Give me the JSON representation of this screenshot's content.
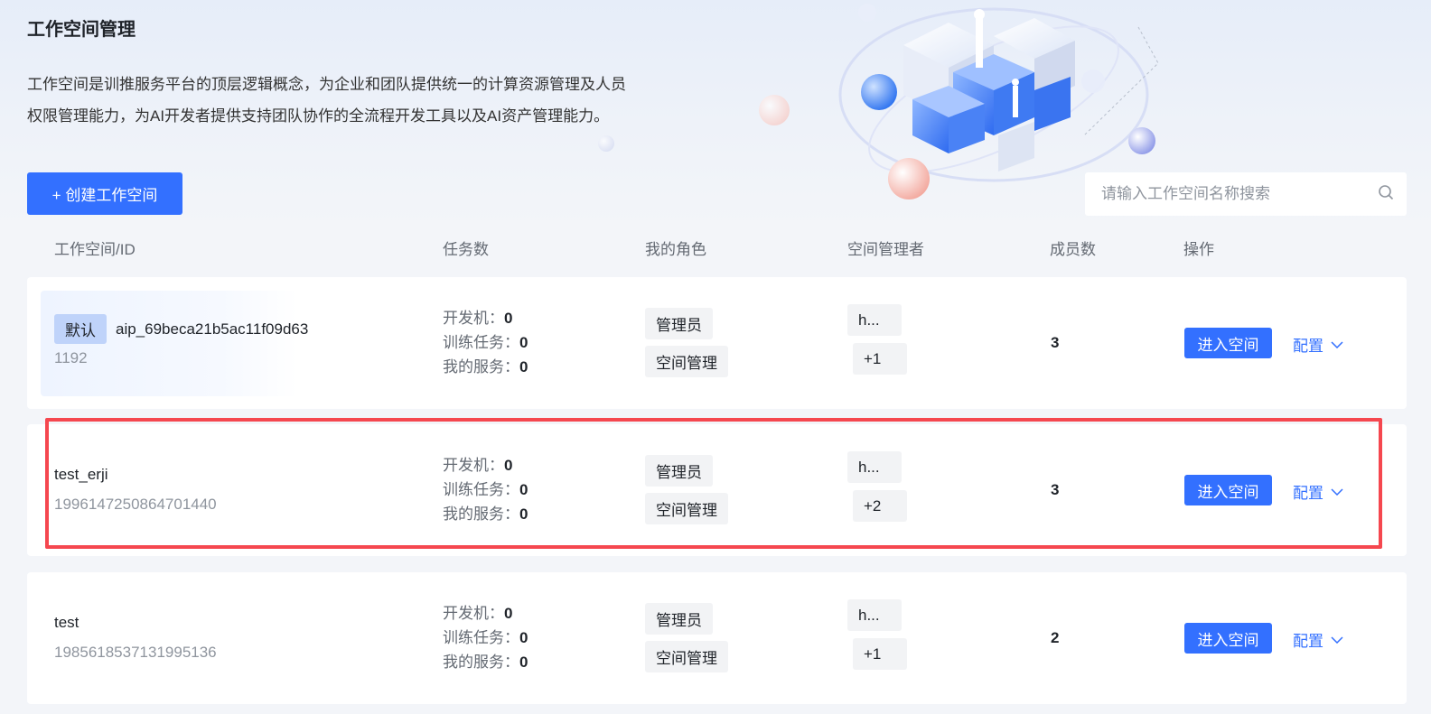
{
  "page": {
    "title": "工作空间管理",
    "intro_line1": "工作空间是训推服务平台的顶层逻辑概念，为企业和团队提供统一的计算资源管理及人员",
    "intro_line2": "权限管理能力，为AI开发者提供支持团队协作的全流程开发工具以及AI资产管理能力。"
  },
  "toolbar": {
    "create_label": "+ 创建工作空间",
    "search_placeholder": "请输入工作空间名称搜索",
    "search_icon": "search-icon"
  },
  "columns": {
    "workspace": "工作空间/ID",
    "tasks": "任务数",
    "role": "我的角色",
    "manager": "空间管理者",
    "members": "成员数",
    "actions": "操作"
  },
  "task_labels": {
    "dev": "开发机：",
    "train": "训练任务：",
    "service": "我的服务："
  },
  "rows": [
    {
      "tag": "默认",
      "name": "aip_69beca21b5ac11f09d63",
      "id": "1192",
      "dev": "0",
      "train": "0",
      "service": "0",
      "role1": "管理员",
      "role2": "空间管理",
      "manager": "h...",
      "manager_more": "+1",
      "members": "3",
      "enter_label": "进入空间",
      "config_label": "配置"
    },
    {
      "name": "test_erji",
      "id": "1996147250864701440",
      "dev": "0",
      "train": "0",
      "service": "0",
      "role1": "管理员",
      "role2": "空间管理",
      "manager": "h...",
      "manager_more": "+2",
      "members": "3",
      "enter_label": "进入空间",
      "config_label": "配置"
    },
    {
      "name": "test",
      "id": "1985618537131995136",
      "dev": "0",
      "train": "0",
      "service": "0",
      "role1": "管理员",
      "role2": "空间管理",
      "manager": "h...",
      "manager_more": "+1",
      "members": "2",
      "enter_label": "进入空间",
      "config_label": "配置"
    }
  ],
  "colors": {
    "primary": "#3370ff",
    "highlight_frame": "#f5474f",
    "tag_bg": "#bfd3fa",
    "chip_bg": "#f2f3f5"
  }
}
